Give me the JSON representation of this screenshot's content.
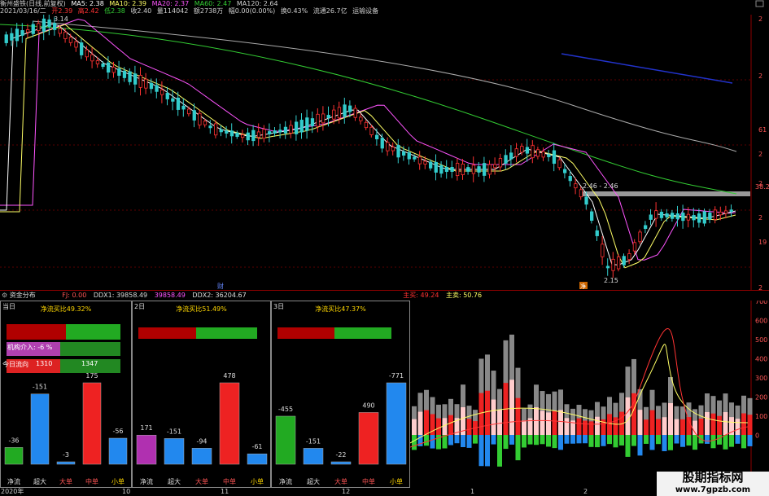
{
  "header": {
    "title": "衡州盛铁(日线,前复权)",
    "ma5": "MA5: 2.38",
    "ma10": "MA10: 2.39",
    "ma20": "MA20: 2.37",
    "ma60": "MA60: 2.47",
    "ma120": "MA120: 2.64",
    "date": "2021/03/16/二",
    "open": "开2.39",
    "high": "高2.42",
    "low": "低2.38",
    "close": "收2.40",
    "volume": "量114042",
    "amount": "额2738万",
    "change": "幅0.00(0.00%)",
    "turnover": "换0.43%",
    "float": "流通26.7亿",
    "industry": "运输设备"
  },
  "price_labels": {
    "high_mark": "3.14",
    "range_mark": "2.46 - 2.46",
    "low_mark": "2.15",
    "right_axis": [
      "2",
      "2",
      "61",
      "2",
      "2",
      "2",
      "19",
      "2"
    ],
    "right_axis_mid": "38.2",
    "marker_cai": "财",
    "marker_jin": "净"
  },
  "fund_bar": {
    "title": "资金分布",
    "fj": "FJ: 0.00",
    "ddx1": "DDX1: 39858.49",
    "ddx1b": "39858.49",
    "ddx2": "DDX2: 36204.67",
    "buy": "主买: 49.24",
    "sell": "主卖: 50.76"
  },
  "panels": [
    {
      "name": "当日",
      "ratio": "净流买比49.32%",
      "jg": "机构介入: -6 %",
      "flow_label": "今日流向",
      "flow_a": "1310",
      "flow_b": "1347",
      "values": [
        "-36",
        "-151",
        "-3",
        "175",
        "-56"
      ]
    },
    {
      "name": "2日",
      "ratio": "净流买比51.49%",
      "values": [
        "171",
        "-151",
        "-94",
        "478",
        "-61"
      ]
    },
    {
      "name": "3日",
      "ratio": "净流买比47.37%",
      "values": [
        "-455",
        "-151",
        "-22",
        "490",
        "-771"
      ]
    }
  ],
  "categories": [
    "净流",
    "超大",
    "大单",
    "中单",
    "小单"
  ],
  "right_ind_axis": [
    "700",
    "600",
    "500",
    "400",
    "300",
    "200",
    "100",
    "0"
  ],
  "time_axis": [
    "2020年",
    "10",
    "11",
    "12",
    "1",
    "2"
  ],
  "watermark": {
    "line1": "股期指标网",
    "line2": "www.7gpzb.com"
  },
  "colors": {
    "up": "#ff3333",
    "down": "#33cccc",
    "ma5": "#ffffff",
    "ma10": "#ffff66",
    "ma20": "#ff55ff",
    "ma60": "#33cc33",
    "ma120": "#aaaaaa"
  }
}
